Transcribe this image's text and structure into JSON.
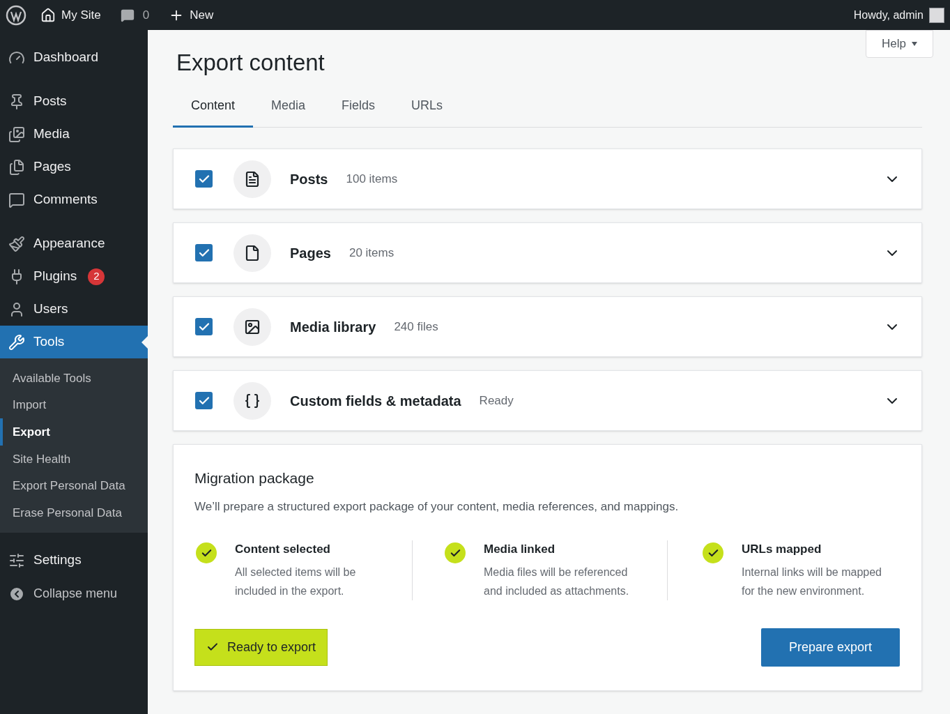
{
  "admin_bar": {
    "site": "My Site",
    "comments": "0",
    "new": "New",
    "greeting": "Howdy, admin"
  },
  "sidebar": {
    "groups": [
      [
        {
          "label": "Dashboard",
          "selected": false
        }
      ],
      [
        {
          "label": "Posts",
          "selected": false
        },
        {
          "label": "Media",
          "selected": false
        },
        {
          "label": "Pages",
          "selected": false
        },
        {
          "label": "Comments",
          "selected": false
        }
      ],
      [
        {
          "label": "Appearance",
          "selected": false
        },
        {
          "label": "Plugins",
          "selected": false,
          "badge": "2"
        },
        {
          "label": "Users",
          "selected": false
        },
        {
          "label": "Tools",
          "selected": true,
          "submenu": [
            {
              "label": "Available Tools",
              "selected": false
            },
            {
              "label": "Import",
              "selected": false
            },
            {
              "label": "Export",
              "selected": true
            },
            {
              "label": "Site Health",
              "selected": false
            },
            {
              "label": "Export Personal Data",
              "selected": false
            },
            {
              "label": "Erase Personal Data",
              "selected": false
            }
          ]
        }
      ],
      [
        {
          "label": "Settings",
          "selected": false
        }
      ]
    ],
    "collapse": "Collapse menu"
  },
  "help": "Help",
  "title": "Export content",
  "tabs": [
    {
      "label": "Content",
      "selected": true
    },
    {
      "label": "Media",
      "selected": false
    },
    {
      "label": "Fields",
      "selected": false
    },
    {
      "label": "URLs",
      "selected": false
    }
  ],
  "sections": [
    {
      "title": "Posts",
      "count": "100 items",
      "checked": true
    },
    {
      "title": "Pages",
      "count": "20 items",
      "checked": true
    },
    {
      "title": "Media library",
      "count": "240 files",
      "checked": true
    },
    {
      "title": "Custom fields & metadata",
      "count": "Ready",
      "checked": true
    }
  ],
  "package": {
    "title": "Migration package",
    "description": "We’ll prepare a structured export package of your content, media references, and mappings.",
    "steps": [
      {
        "title": "Content selected",
        "text": "All selected items will be included in the export."
      },
      {
        "title": "Media linked",
        "text": "Media files will be referenced and included as attachments."
      },
      {
        "title": "URLs mapped",
        "text": "Internal links will be mapped for the new environment."
      }
    ],
    "status": "Ready to export",
    "action": "Prepare export"
  }
}
